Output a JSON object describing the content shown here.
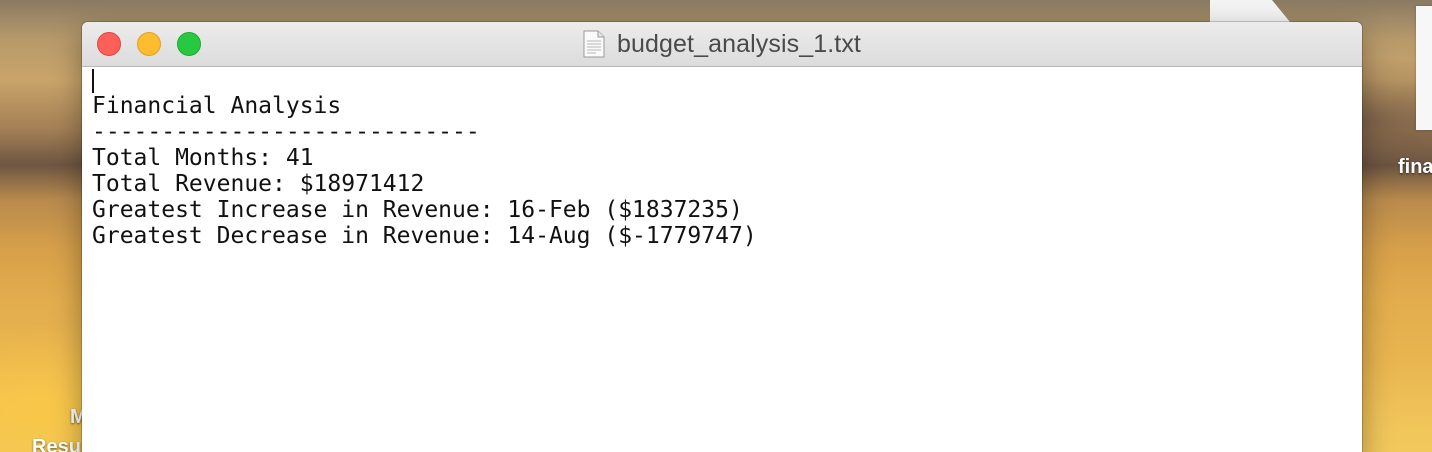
{
  "desktop": {
    "label_right": "fina",
    "label_left_1": "M",
    "label_left_2": "Resu"
  },
  "window": {
    "title": "budget_analysis_1.txt",
    "icon": "text-document-icon",
    "buttons": {
      "close": "close-button",
      "minimize": "minimize-button",
      "zoom": "zoom-button"
    },
    "colors": {
      "close": "#fe5f57",
      "minimize": "#febc2e",
      "zoom": "#28c840"
    }
  },
  "document": {
    "lines": [
      "Financial Analysis",
      "----------------------------",
      "Total Months: 41",
      "Total Revenue: $18971412",
      "Greatest Increase in Revenue: 16-Feb ($1837235)",
      "Greatest Decrease in Revenue: 14-Aug ($-1779747)"
    ]
  }
}
